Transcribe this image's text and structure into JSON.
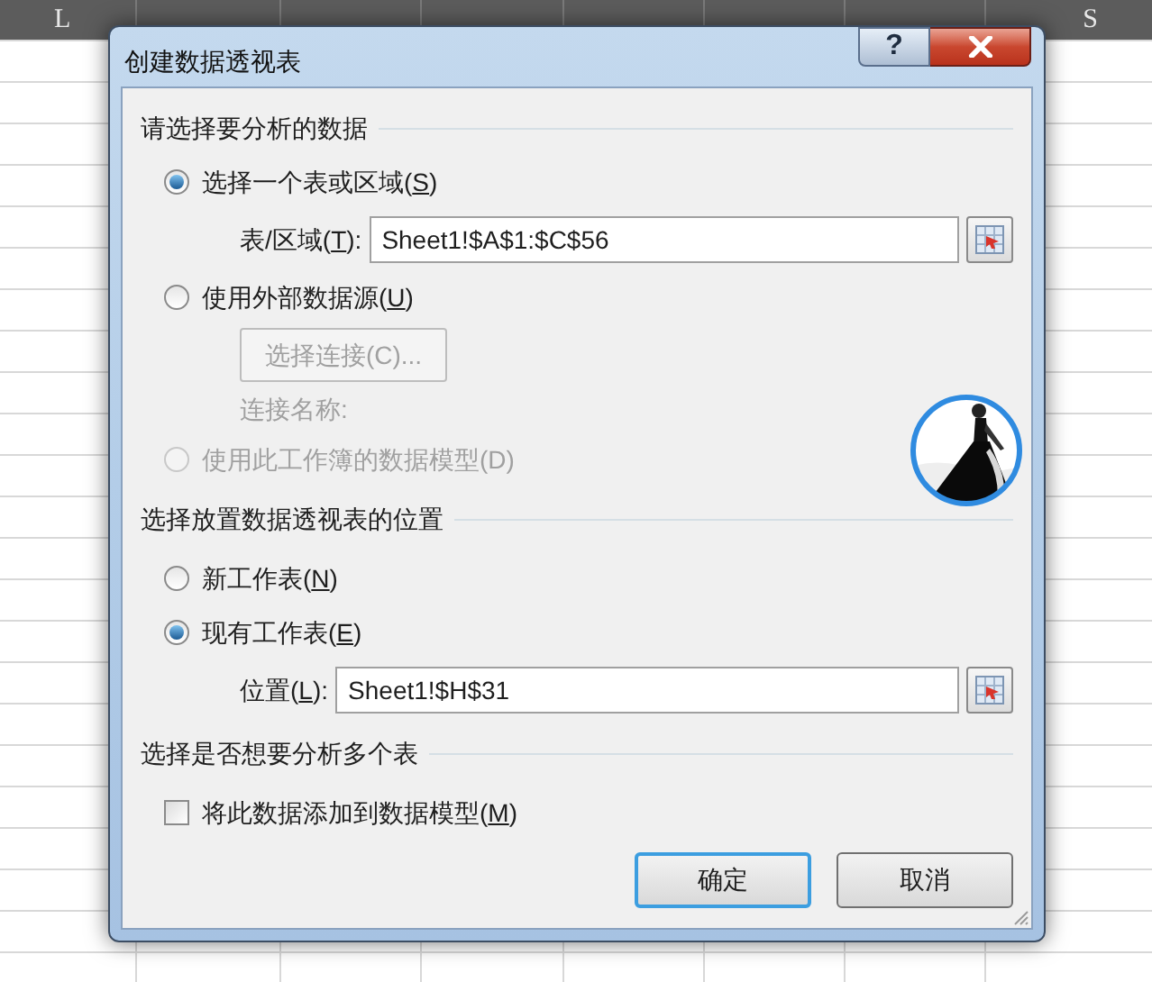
{
  "sheet": {
    "first_column": "L",
    "last_column": "S"
  },
  "dialog": {
    "title": "创建数据透视表",
    "help_button": "?",
    "sections": [
      {
        "heading": "请选择要分析的数据",
        "items": [
          {
            "kind": "radio",
            "text": "选择一个表或区域(",
            "accel": "S",
            "after": ")",
            "selected": true,
            "disabled": false
          },
          {
            "kind": "range",
            "text": "表/区域(",
            "accel": "T",
            "after": "):",
            "value": "Sheet1!$A$1:$C$56"
          },
          {
            "kind": "radio",
            "text": "使用外部数据源(",
            "accel": "U",
            "after": ")",
            "selected": false,
            "disabled": false
          },
          {
            "kind": "button",
            "text": "选择连接(C)...",
            "disabled": true
          },
          {
            "kind": "note",
            "text": "连接名称:",
            "disabled": true
          },
          {
            "kind": "radio",
            "text": "使用此工作簿的数据模型(D)",
            "selected": false,
            "disabled": true
          }
        ]
      },
      {
        "heading": "选择放置数据透视表的位置",
        "items": [
          {
            "kind": "radio",
            "text": "新工作表(",
            "accel": "N",
            "after": ")",
            "selected": false,
            "disabled": false
          },
          {
            "kind": "radio",
            "text": "现有工作表(",
            "accel": "E",
            "after": ")",
            "selected": true,
            "disabled": false
          },
          {
            "kind": "range",
            "text": "位置(",
            "accel": "L",
            "after": "):",
            "value": "Sheet1!$H$31"
          }
        ]
      },
      {
        "heading": "选择是否想要分析多个表",
        "items": [
          {
            "kind": "checkbox",
            "text": "将此数据添加到数据模型(",
            "accel": "M",
            "after": ")",
            "checked": false,
            "disabled": false
          }
        ]
      }
    ],
    "buttons": [
      {
        "label": "确定",
        "default": true
      },
      {
        "label": "取消",
        "default": false
      }
    ]
  }
}
